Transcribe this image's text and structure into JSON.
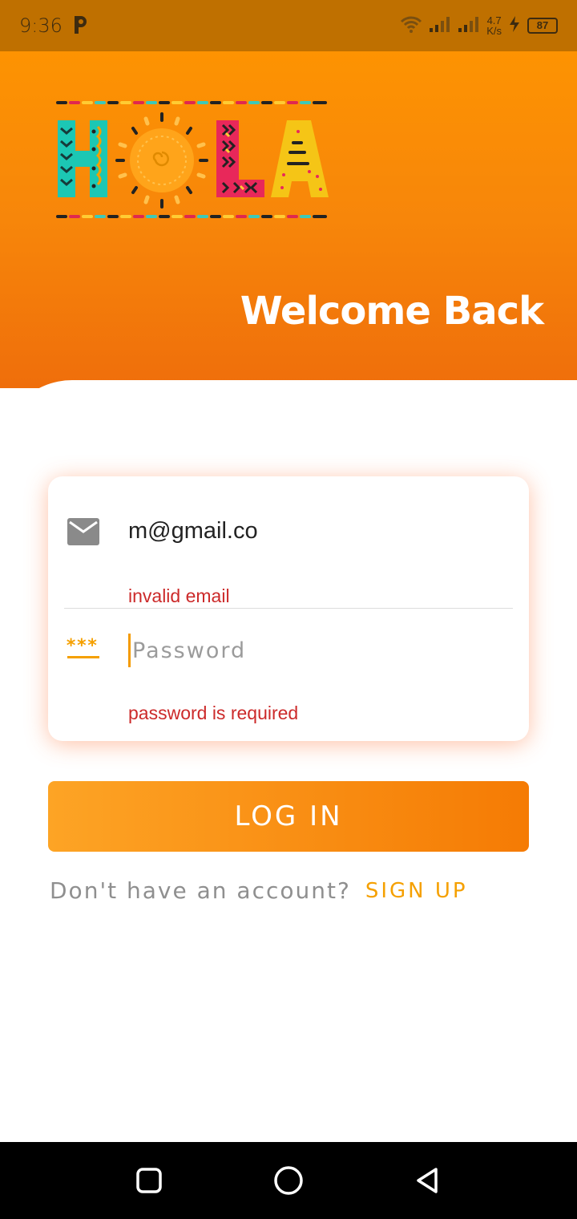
{
  "status_bar": {
    "time": "9:36",
    "network_speed_value": "4.7",
    "network_speed_unit": "K/s",
    "battery": "87",
    "icons": [
      "app-p-icon",
      "wifi-icon",
      "signal-icon",
      "signal-icon",
      "charging-icon",
      "battery-icon"
    ]
  },
  "header": {
    "logo_text": "HOLA",
    "welcome": "Welcome Back"
  },
  "form": {
    "email_value": "m@gmail.co",
    "email_error": "invalid email",
    "password_placeholder": "Password",
    "password_error": "password is required",
    "password_icon_glyph": "***"
  },
  "login_button": "LOG IN",
  "signup": {
    "question": "Don't have an account?",
    "link": "SIGN UP"
  },
  "colors": {
    "accent": "#f5a000",
    "header_top": "#fd9302",
    "header_bottom": "#ef6e0b",
    "error": "#cc2a2a",
    "status_bar": "#bf7000"
  },
  "nav_bar": {
    "icons": [
      "recents-icon",
      "home-icon",
      "back-icon"
    ]
  }
}
